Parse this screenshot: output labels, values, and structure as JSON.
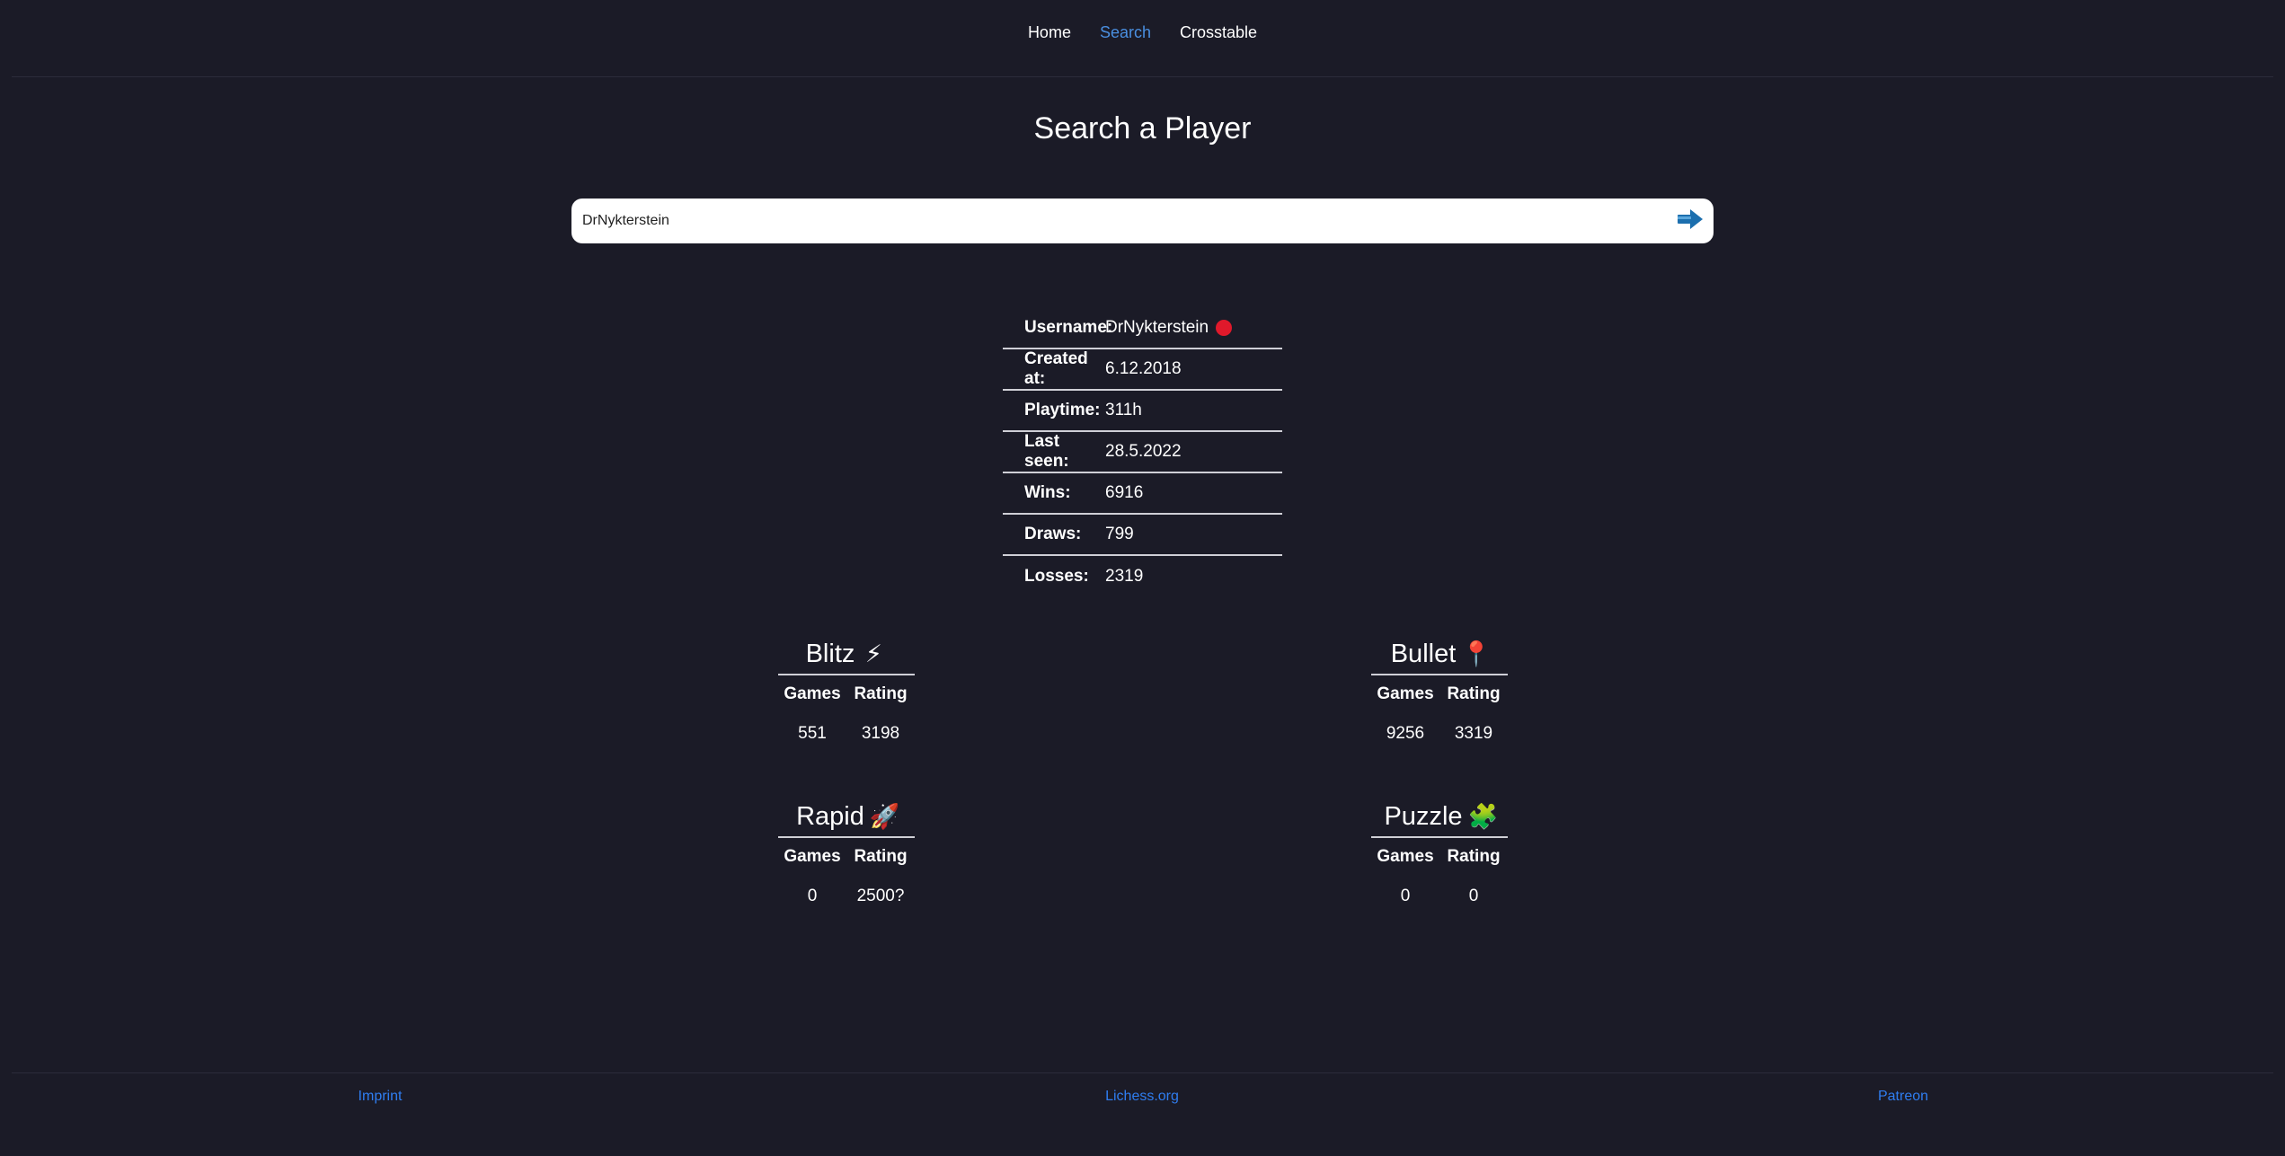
{
  "nav": {
    "items": [
      {
        "label": "Home",
        "active": false
      },
      {
        "label": "Search",
        "active": true
      },
      {
        "label": "Crosstable",
        "active": false
      }
    ]
  },
  "page": {
    "title": "Search a Player"
  },
  "search": {
    "value": "DrNykterstein",
    "submit_icon": "arrow-right-icon",
    "accent": "#1c6fae"
  },
  "profile": {
    "status_color": "#e0192b",
    "rows": [
      {
        "key": "Username:",
        "value": "DrNykterstein"
      },
      {
        "key": "Created at:",
        "value": "6.12.2018"
      },
      {
        "key": "Playtime:",
        "value": "311h"
      },
      {
        "key": "Last seen:",
        "value": "28.5.2022"
      },
      {
        "key": "Wins:",
        "value": "6916"
      },
      {
        "key": "Draws:",
        "value": "799"
      },
      {
        "key": "Losses:",
        "value": "2319"
      }
    ]
  },
  "modes": {
    "blitz": {
      "title": "Blitz",
      "emoji": "⚡",
      "games_label": "Games",
      "rating_label": "Rating",
      "games": "551",
      "rating": "3198"
    },
    "bullet": {
      "title": "Bullet",
      "emoji": "📍",
      "games_label": "Games",
      "rating_label": "Rating",
      "games": "9256",
      "rating": "3319"
    },
    "rapid": {
      "title": "Rapid",
      "emoji": "🚀",
      "games_label": "Games",
      "rating_label": "Rating",
      "games": "0",
      "rating": "2500?"
    },
    "puzzle": {
      "title": "Puzzle",
      "emoji": "🧩",
      "games_label": "Games",
      "rating_label": "Rating",
      "games": "0",
      "rating": "0"
    }
  },
  "footer": {
    "links": [
      "Imprint",
      "Lichess.org",
      "Patreon"
    ],
    "link_color": "#2f7df0"
  }
}
